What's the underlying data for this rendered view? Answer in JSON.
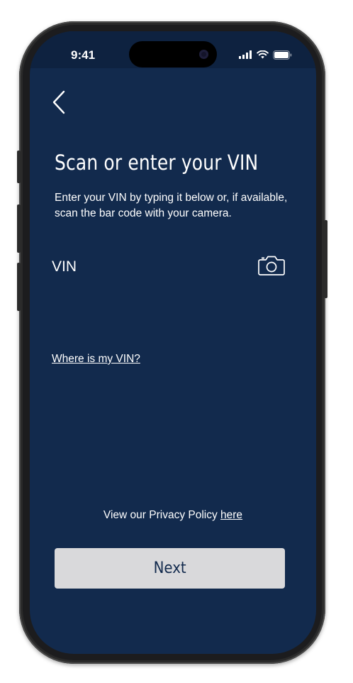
{
  "status_bar": {
    "time": "9:41"
  },
  "header": {
    "back_label": "Back"
  },
  "main": {
    "title": "Scan or enter your VIN",
    "description": "Enter your VIN by typing it below or, if available, scan the bar code with your camera.",
    "vin_field": {
      "placeholder": "VIN",
      "value": ""
    },
    "where_link": "Where is my VIN?",
    "privacy_text": "View our Privacy Policy ",
    "privacy_link": "here",
    "next_button": "Next"
  },
  "colors": {
    "background": "#122a4d",
    "button": "#d9d9db",
    "text": "#ffffff"
  },
  "icons": {
    "back": "chevron-left-icon",
    "camera": "camera-icon"
  }
}
